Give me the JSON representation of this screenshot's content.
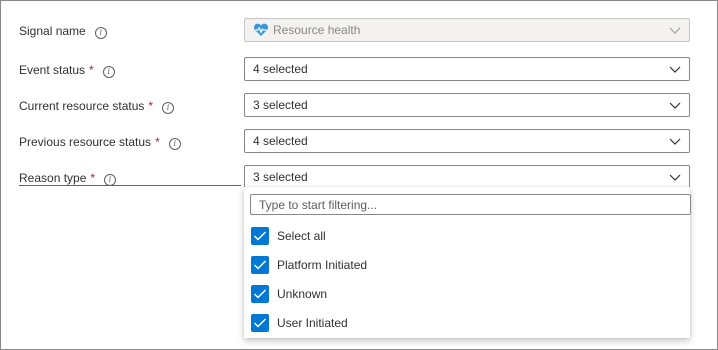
{
  "form": {
    "signal_name": {
      "label": "Signal name",
      "value": "Resource health",
      "icon": "heart-pulse-icon"
    },
    "event_status": {
      "label": "Event status",
      "required": "*",
      "value": "4 selected"
    },
    "current_resource_status": {
      "label": "Current resource status",
      "required": "*",
      "value": "3 selected"
    },
    "previous_resource_status": {
      "label": "Previous resource status",
      "required": "*",
      "value": "4 selected"
    },
    "reason_type": {
      "label": "Reason type",
      "required": "*",
      "value": "3 selected"
    }
  },
  "reason_dropdown": {
    "filter_placeholder": "Type to start filtering...",
    "options": [
      {
        "label": "Select all",
        "checked": true
      },
      {
        "label": "Platform Initiated",
        "checked": true
      },
      {
        "label": "Unknown",
        "checked": true
      },
      {
        "label": "User Initiated",
        "checked": true
      }
    ]
  },
  "colors": {
    "accent": "#0078d4",
    "required": "#a4262c",
    "error_underline": "#d13438"
  }
}
